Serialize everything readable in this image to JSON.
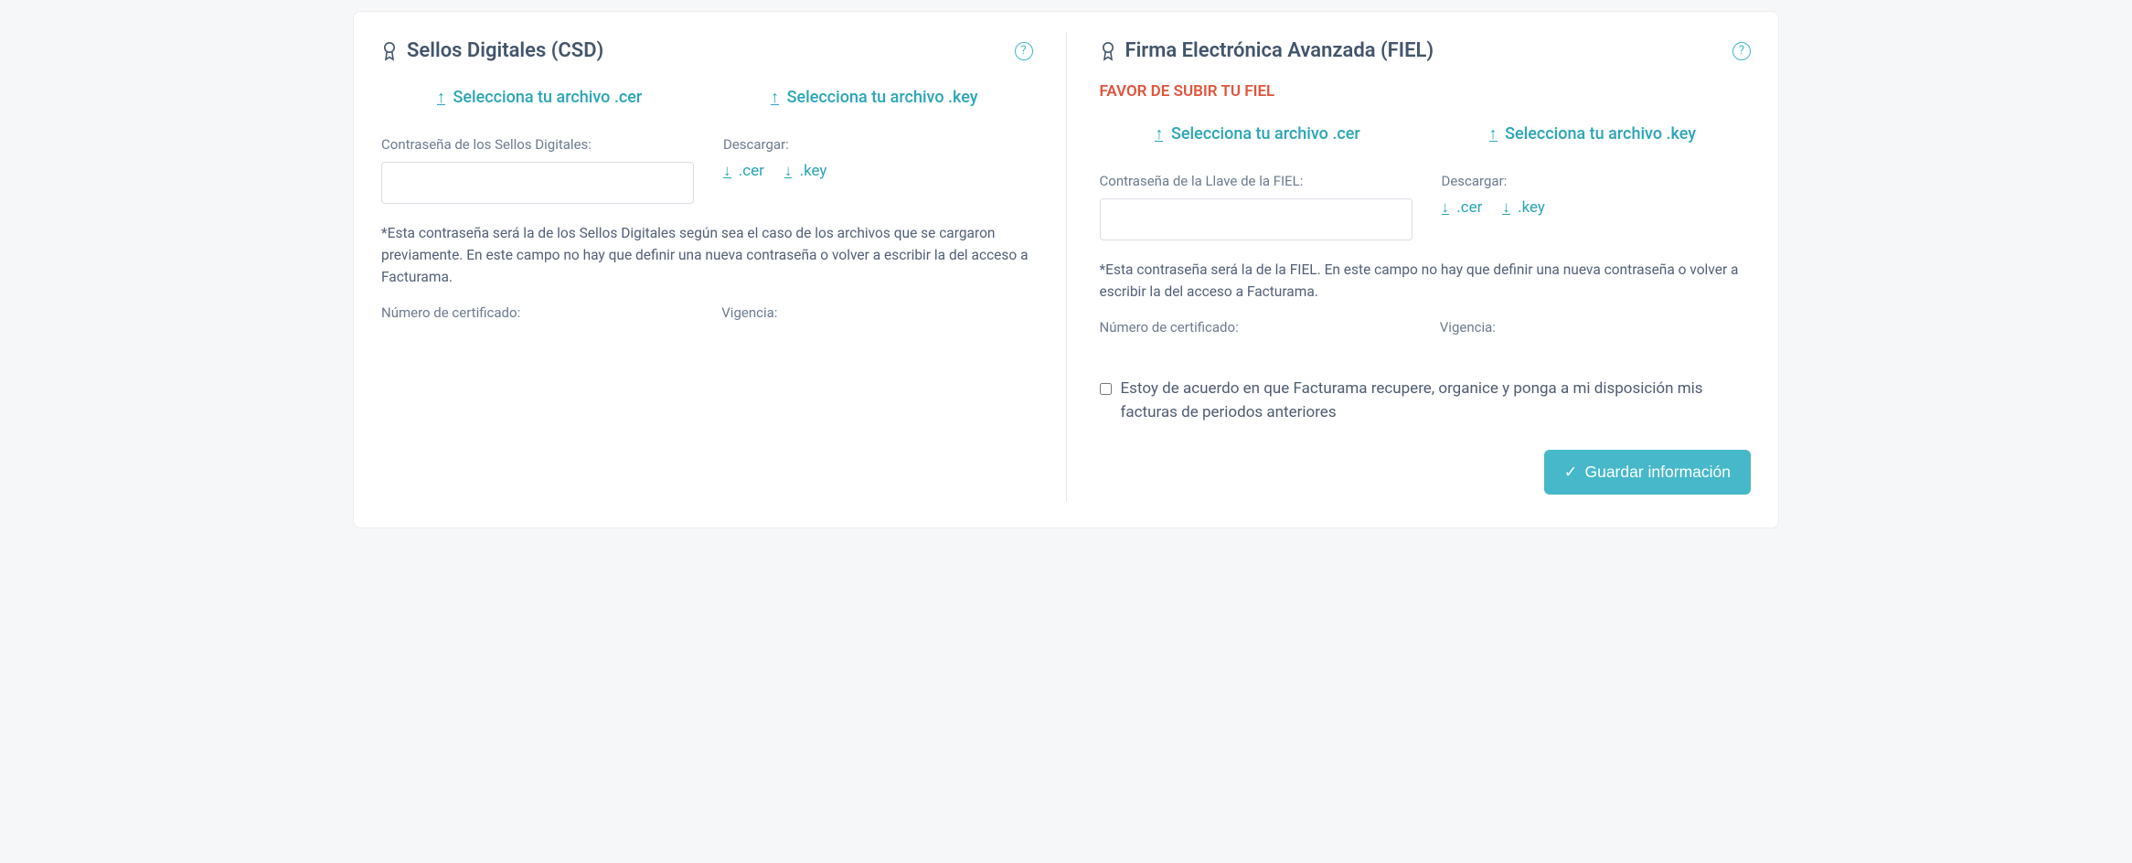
{
  "csd": {
    "title": "Sellos Digitales (CSD)",
    "upload_cer": "Selecciona tu archivo .cer",
    "upload_key": "Selecciona tu archivo .key",
    "password_label": "Contraseña de los Sellos Digitales:",
    "password_value": "",
    "download_label": "Descargar:",
    "download_cer": ".cer",
    "download_key": ".key",
    "note": "*Esta contraseña será la de los Sellos Digitales según sea el caso de los archivos que se cargaron previamente. En este campo no hay que definir una nueva contraseña o volver a escribir la del acceso a Facturama.",
    "cert_no_label": "Número de certificado:",
    "validity_label": "Vigencia:"
  },
  "fiel": {
    "title": "Firma Electrónica Avanzada (FIEL)",
    "warning": "FAVOR DE SUBIR TU FIEL",
    "upload_cer": "Selecciona tu archivo .cer",
    "upload_key": "Selecciona tu archivo .key",
    "password_label": "Contraseña de la Llave de la FIEL:",
    "password_value": "",
    "download_label": "Descargar:",
    "download_cer": ".cer",
    "download_key": ".key",
    "note": "*Esta contraseña será la de la FIEL. En este campo no hay que definir una nueva contraseña o volver a escribir la del acceso a Facturama.",
    "cert_no_label": "Número de certificado:",
    "validity_label": "Vigencia:"
  },
  "consent": {
    "label": "Estoy de acuerdo en que Facturama recupere, organice y ponga a mi disposición mis facturas de periodos anteriores"
  },
  "actions": {
    "save": "Guardar información"
  }
}
